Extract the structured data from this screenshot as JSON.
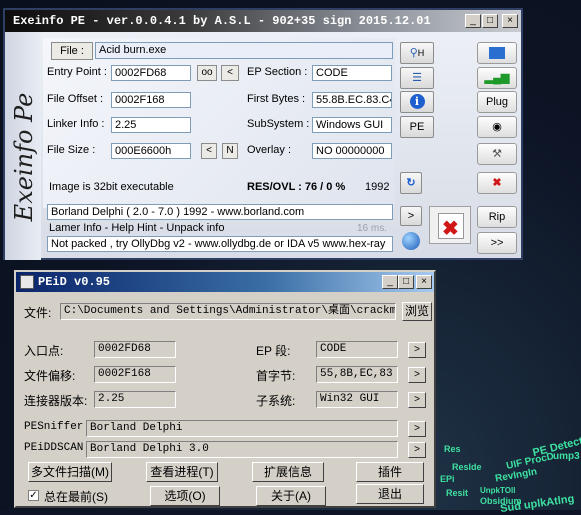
{
  "exeinfo": {
    "title": "Exeinfo PE - ver.0.0.4.1  by A.S.L - 902+35 sign 2015.12.01",
    "logo": "Exeinfo Pe",
    "file_button": "File :",
    "file_value": "Acid burn.exe",
    "entry_point_label": "Entry Point :",
    "entry_point_value": "0002FD68",
    "entry_btn_oo": "oo",
    "entry_btn_lt": "<",
    "ep_section_label": "EP Section :",
    "ep_section_value": "CODE",
    "file_offset_label": "File Offset :",
    "file_offset_value": "0002F168",
    "first_bytes_label": "First Bytes :",
    "first_bytes_value": "55.8B.EC.83.C4",
    "linker_info_label": "Linker Info :",
    "linker_info_value": "2.25",
    "subsystem_label": "SubSystem :",
    "subsystem_value": "Windows GUI",
    "file_size_label": "File Size :",
    "file_size_value": "000E6600h",
    "size_btn_lt": "<",
    "size_btn_n": "N",
    "overlay_label": "Overlay :",
    "overlay_value": "NO  00000000",
    "image_info": "Image is 32bit executable",
    "res_ovl": "RES/OVL : 76 / 0 %",
    "year": "1992",
    "detect_line": "Borland Delphi ( 2.0 - 7.0 ) 1992 - www.borland.com",
    "hint_line": "Lamer Info - Help Hint - Unpack info",
    "time_ms": "16 ms.",
    "unpack_line": "Not packed , try OllyDbg v2 - www.ollydbg.de or IDA v5 www.hex-ray",
    "side_buttons": {
      "h": "H",
      "pe": "PE",
      "plug": "Plug",
      "rip": "Rip",
      "next": ">>",
      "go": ">"
    }
  },
  "peid": {
    "title": "PEiD v0.95",
    "file_label": "文件:",
    "file_path": "C:\\Documents and Settings\\Administrator\\桌面\\crackme\\01",
    "browse": "浏览",
    "entry_label": "入口点:",
    "entry_value": "0002FD68",
    "offset_label": "文件偏移:",
    "offset_value": "0002F168",
    "linker_label": "连接器版本:",
    "linker_value": "2.25",
    "ep_label": "EP 段:",
    "ep_value": "CODE",
    "first_label": "首字节:",
    "first_value": "55,8B,EC,83",
    "subsys_label": "子系统:",
    "subsys_value": "Win32 GUI",
    "pesniffer_label": "PESniffer:",
    "pesniffer_value": "Borland Delphi",
    "peidscan_label": "PEiDDSCAN:",
    "peidscan_value": "Borland Delphi 3.0",
    "arrow": ">",
    "btn_multi": "多文件扫描(M)",
    "btn_process": "查看进程(T)",
    "btn_ext": "扩展信息",
    "btn_plugin": "插件",
    "ontop_label": "总在最前(S)",
    "btn_options": "选项(O)",
    "btn_about": "关于(A)",
    "btn_exit": "退出"
  },
  "desktop": {
    "line1": "PE Detectiv",
    "line2": "UIF ProcD",
    "line3": "RevIngIn",
    "line4": "Obsidium",
    "line5": "UnpkTOll",
    "line6": "Sud uplkAtlng",
    "line7": "ump3",
    "line8": "Reslde",
    "line9": "Res",
    "line10": "EPi",
    "line11": "Resit"
  }
}
